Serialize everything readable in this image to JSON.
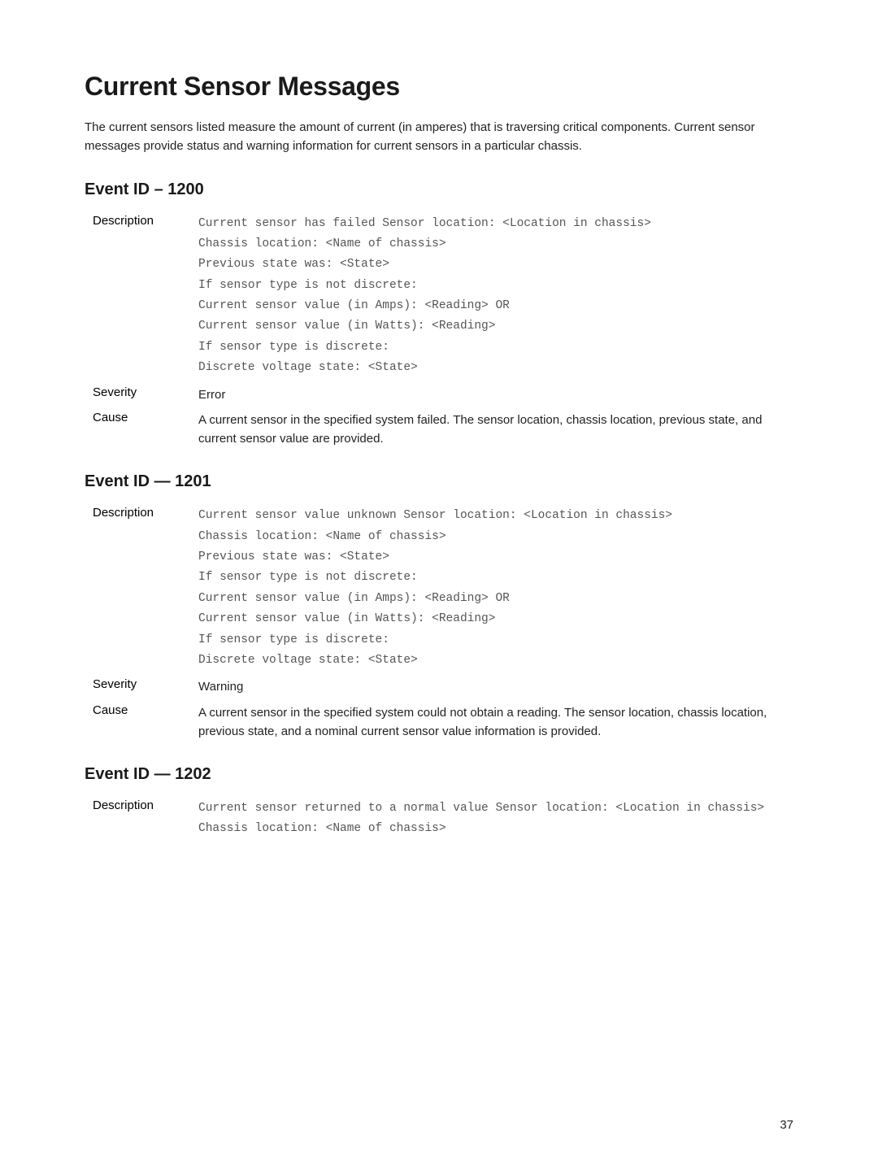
{
  "title": "Current Sensor Messages",
  "intro": "The current sensors listed measure the amount of current (in amperes) that is traversing critical components. Current sensor messages provide status and warning information for current sensors in a particular chassis.",
  "events": [
    {
      "heading": "Event ID – 1200",
      "description_lines": [
        "Current sensor has failed Sensor location: <Location in chassis>",
        "Chassis location: <Name of chassis>",
        "Previous state was: <State>",
        "If sensor type is not discrete:",
        "Current sensor value (in Amps): <Reading> OR",
        "Current sensor value (in Watts): <Reading>",
        "If sensor type is discrete:",
        "Discrete voltage state: <State>"
      ],
      "severity": "Error",
      "cause": "A current sensor in the specified system failed. The sensor location, chassis location, previous state, and current sensor value are provided."
    },
    {
      "heading": "Event ID — 1201",
      "description_lines": [
        "Current sensor value unknown Sensor location: <Location in chassis>",
        "Chassis location: <Name of chassis>",
        "Previous state was: <State>",
        "If sensor type is not discrete:",
        "Current sensor value (in Amps): <Reading> OR",
        "Current sensor value (in Watts): <Reading>",
        "If sensor type is discrete:",
        "Discrete voltage state: <State>"
      ],
      "severity": "Warning",
      "cause": "A current sensor in the specified system could not obtain a reading. The sensor location, chassis location, previous state, and a nominal current sensor value information is provided."
    },
    {
      "heading": "Event ID — 1202",
      "description_lines": [
        "Current sensor returned to a normal value Sensor location: <Location in chassis>",
        "Chassis location: <Name of chassis>"
      ],
      "severity": null,
      "cause": null
    }
  ],
  "labels": {
    "description": "Description",
    "severity": "Severity",
    "cause": "Cause"
  },
  "page_number": "37"
}
